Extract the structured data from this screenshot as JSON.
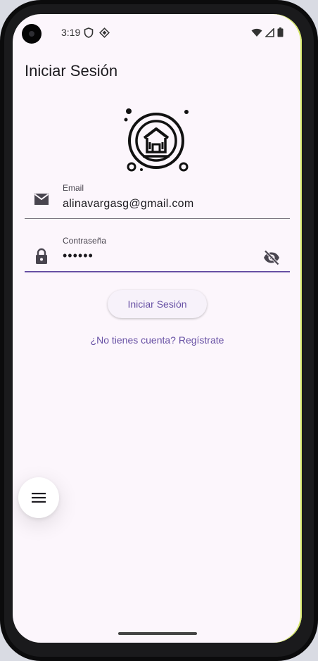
{
  "status_bar": {
    "time": "3:19"
  },
  "app_bar": {
    "title": "Iniciar Sesión"
  },
  "form": {
    "email": {
      "label": "Email",
      "value": "alinavargasg@gmail.com"
    },
    "password": {
      "label": "Contraseña",
      "value": "••••••"
    }
  },
  "actions": {
    "login_label": "Iniciar Sesión",
    "register_link": "¿No tienes cuenta? Regístrate"
  },
  "icons": {
    "email": "mail-icon",
    "password": "lock-icon",
    "visibility": "visibility-off-icon",
    "menu": "menu-icon",
    "logo": "bank-building-icon"
  },
  "colors": {
    "primary": "#6750a4",
    "background": "#fcf6fc",
    "text": "#1d1b20"
  }
}
